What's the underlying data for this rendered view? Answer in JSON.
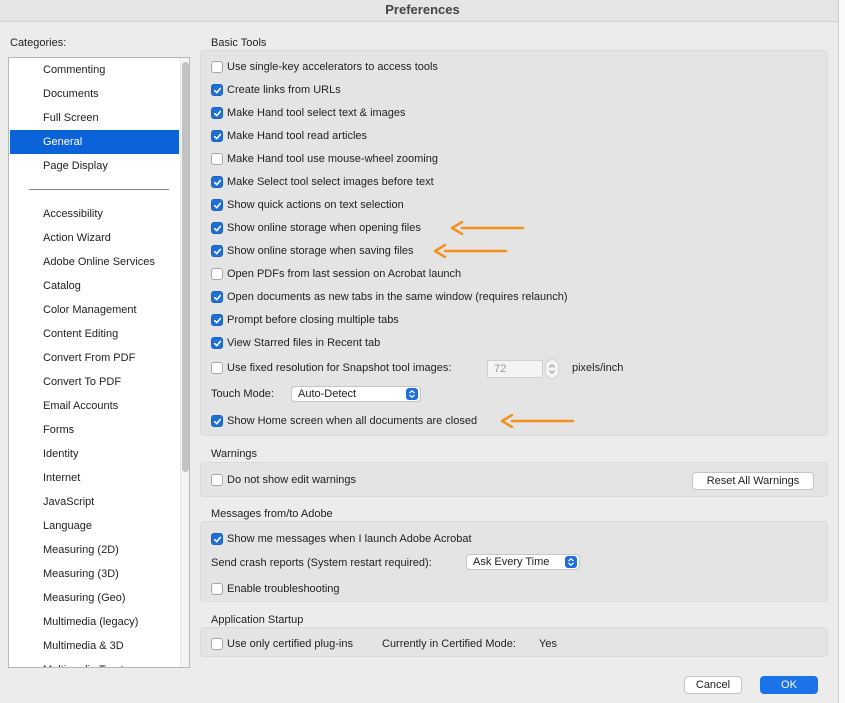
{
  "window": {
    "title": "Preferences"
  },
  "categories": {
    "label": "Categories:",
    "top_items": [
      "Commenting",
      "Documents",
      "Full Screen",
      "General",
      "Page Display"
    ],
    "selected": "General",
    "items": [
      "Accessibility",
      "Action Wizard",
      "Adobe Online Services",
      "Catalog",
      "Color Management",
      "Content Editing",
      "Convert From PDF",
      "Convert To PDF",
      "Email Accounts",
      "Forms",
      "Identity",
      "Internet",
      "JavaScript",
      "Language",
      "Measuring (2D)",
      "Measuring (3D)",
      "Measuring (Geo)",
      "Multimedia (legacy)",
      "Multimedia & 3D",
      "Multimedia Trust"
    ]
  },
  "basic_tools": {
    "title": "Basic Tools",
    "options": [
      {
        "label": "Use single-key accelerators to access tools",
        "checked": false
      },
      {
        "label": "Create links from URLs",
        "checked": true
      },
      {
        "label": "Make Hand tool select text & images",
        "checked": true
      },
      {
        "label": "Make Hand tool read articles",
        "checked": true
      },
      {
        "label": "Make Hand tool use mouse-wheel zooming",
        "checked": false
      },
      {
        "label": "Make Select tool select images before text",
        "checked": true
      },
      {
        "label": "Show quick actions on text selection",
        "checked": true
      },
      {
        "label": "Show online storage when opening files",
        "checked": true
      },
      {
        "label": "Show online storage when saving files",
        "checked": true
      },
      {
        "label": "Open PDFs from last session on Acrobat launch",
        "checked": false
      },
      {
        "label": "Open documents as new tabs in the same window (requires relaunch)",
        "checked": true
      },
      {
        "label": "Prompt before closing multiple tabs",
        "checked": true
      },
      {
        "label": "View Starred files in Recent tab",
        "checked": true
      }
    ],
    "snapshot": {
      "label": "Use fixed resolution for Snapshot tool images:",
      "checked": false,
      "value": "72",
      "unit": "pixels/inch"
    },
    "touch_mode": {
      "label": "Touch Mode:",
      "value": "Auto-Detect"
    },
    "home_screen": {
      "label": "Show Home screen when all documents are closed",
      "checked": true
    }
  },
  "warnings": {
    "title": "Warnings",
    "option": {
      "label": "Do not show edit warnings",
      "checked": false
    },
    "reset_label": "Reset All Warnings"
  },
  "messages": {
    "title": "Messages from/to Adobe",
    "show_messages": {
      "label": "Show me messages when I launch Adobe Acrobat",
      "checked": true
    },
    "crash_reports": {
      "label": "Send crash reports (System restart required):",
      "value": "Ask Every Time"
    },
    "troubleshooting": {
      "label": "Enable troubleshooting",
      "checked": false
    }
  },
  "startup": {
    "title": "Application Startup",
    "certified": {
      "label": "Use only certified plug-ins",
      "checked": false
    },
    "mode_label": "Currently in Certified Mode:",
    "mode_value": "Yes"
  },
  "footer": {
    "cancel_label": "Cancel",
    "ok_label": "OK"
  },
  "colors": {
    "accent": "#1a73e8",
    "selection": "#0a63d8",
    "arrow": "#f5901e"
  }
}
